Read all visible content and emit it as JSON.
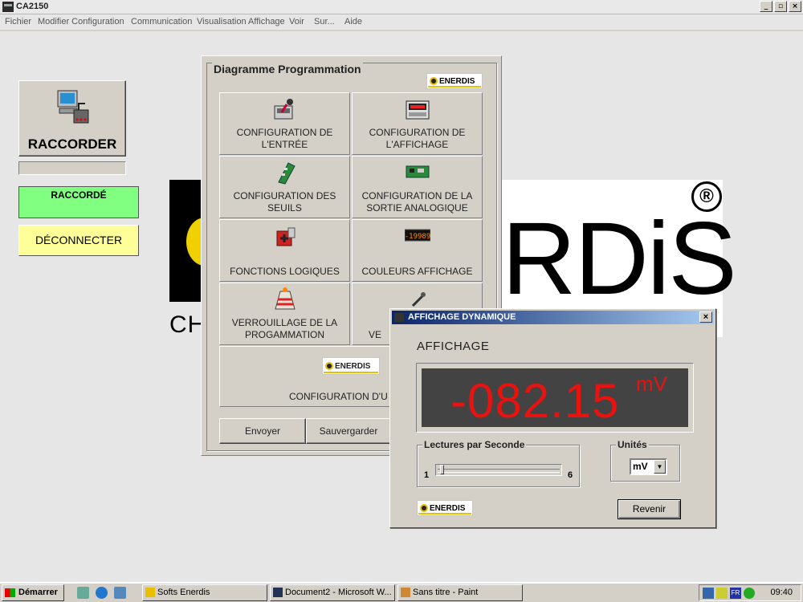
{
  "window": {
    "title": "CA2150",
    "controls": [
      "_",
      "▫",
      "×"
    ]
  },
  "menu": {
    "items": [
      "Fichier",
      "Modifier Configuration",
      "Communication",
      "Visualisation Affichage",
      "Voir",
      "Sur...",
      "Aide"
    ]
  },
  "connection": {
    "connect_label": "RACCORDER",
    "status_label": "RACCORDÉ",
    "disconnect_label": "DÉCONNECTER",
    "status_color": "#80ff80",
    "disconnect_color": "#ffff99"
  },
  "background_logo": {
    "left_text": "CH",
    "right_text": "RDiS",
    "registered": "®"
  },
  "diagram": {
    "title": "Diagramme Programmation",
    "brand": "ENERDIS",
    "items": [
      {
        "label": "CONFIGURATION DE L'ENTRÉE",
        "icon": "input-config-icon"
      },
      {
        "label": "CONFIGURATION DE L'AFFICHAGE",
        "icon": "display-config-icon"
      },
      {
        "label": "CONFIGURATION DES SEUILS",
        "icon": "thresholds-config-icon"
      },
      {
        "label": "CONFIGURATION DE LA SORTIE ANALOGIQUE",
        "icon": "analog-output-icon"
      },
      {
        "label": "FONCTIONS LOGIQUES",
        "icon": "logic-functions-icon"
      },
      {
        "label": "COULEURS AFFICHAGE",
        "icon": "display-colors-icon"
      },
      {
        "label": "VERROUILLAGE DE LA PROGAMMATION",
        "icon": "lock-programming-icon"
      },
      {
        "label": "VE",
        "icon": "tools-icon"
      },
      {
        "label": "CONFIGURATION D'U",
        "icon": "enerdis-logo-icon"
      }
    ],
    "buttons": {
      "send": "Envoyer",
      "save": "Sauvergarder"
    }
  },
  "dynamic_display": {
    "title": "AFFICHAGE DYNAMIQUE",
    "section_label": "AFFICHAGE",
    "value": "-082.15",
    "unit": "mV",
    "value_color": "#e8120f",
    "readings": {
      "label": "Lectures par Seconde",
      "min": "1",
      "max": "6",
      "current": 1
    },
    "units": {
      "label": "Unités",
      "selected": "mV"
    },
    "brand": "ENERDIS",
    "back_button": "Revenir"
  },
  "taskbar": {
    "start_label": "Démarrer",
    "tasks": [
      "Softs Enerdis",
      "Document2 - Microsoft W...",
      "Sans titre - Paint"
    ],
    "tray_lang": "FR",
    "clock": "09:40"
  }
}
